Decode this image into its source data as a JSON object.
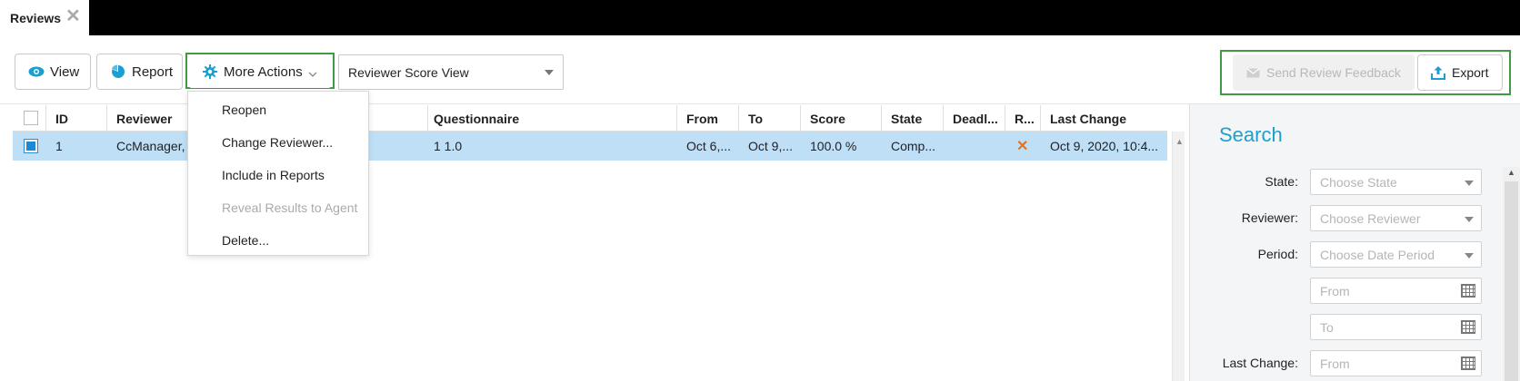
{
  "tab": {
    "label": "Reviews",
    "close": "✕"
  },
  "toolbar": {
    "view_label": "View",
    "report_label": "Report",
    "more_actions_label": "More Actions",
    "view_select_value": "Reviewer Score View",
    "send_feedback_label": "Send Review Feedback",
    "export_label": "Export"
  },
  "menu": {
    "items": [
      {
        "label": "Reopen",
        "disabled": false
      },
      {
        "label": "Change Reviewer...",
        "disabled": false
      },
      {
        "label": "Include in Reports",
        "disabled": false
      },
      {
        "label": "Reveal Results to Agent",
        "disabled": true
      },
      {
        "label": "Delete...",
        "disabled": false
      }
    ]
  },
  "table": {
    "headers": [
      "ID",
      "Reviewer",
      "Questionnaire",
      "From",
      "To",
      "Score",
      "State",
      "Deadl...",
      "R...",
      "Last Change"
    ],
    "rows": [
      {
        "id": "1",
        "reviewer": "CcManager,",
        "questionnaire": "1 1.0",
        "from": "Oct 6,...",
        "to": "Oct 9,...",
        "score": "100.0 %",
        "state": "Comp...",
        "deadline": "",
        "r": "✕",
        "last_change": "Oct 9, 2020, 10:4..."
      }
    ]
  },
  "search": {
    "title": "Search",
    "state_label": "State:",
    "state_placeholder": "Choose State",
    "reviewer_label": "Reviewer:",
    "reviewer_placeholder": "Choose Reviewer",
    "period_label": "Period:",
    "period_placeholder": "Choose Date Period",
    "from_placeholder": "From",
    "to_placeholder": "To",
    "last_change_label": "Last Change:",
    "last_change_from_placeholder": "From"
  },
  "colors": {
    "accent": "#1b9fd0",
    "highlight": "#3e9a43",
    "selected_row": "#bfdff7",
    "remove_x": "#e8731f"
  }
}
